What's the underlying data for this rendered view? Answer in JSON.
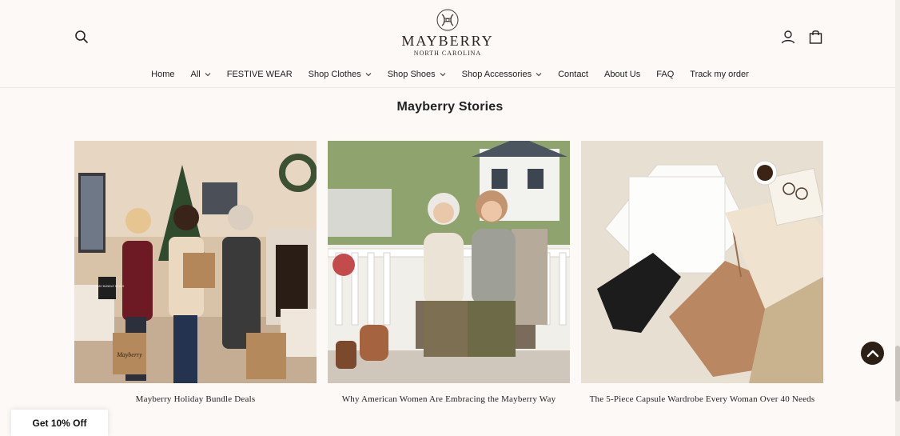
{
  "brand": {
    "name": "MAYBERRY",
    "location": "NORTH CAROLINA"
  },
  "header": {
    "search_icon": "search-icon",
    "account_icon": "user-icon",
    "cart_icon": "shopping-bag-icon"
  },
  "nav": {
    "items": [
      {
        "label": "Home",
        "dropdown": false
      },
      {
        "label": "All",
        "dropdown": true
      },
      {
        "label": "FESTIVE WEAR",
        "dropdown": false
      },
      {
        "label": "Shop Clothes",
        "dropdown": true
      },
      {
        "label": "Shop Shoes",
        "dropdown": true
      },
      {
        "label": "Shop Accessories",
        "dropdown": true
      },
      {
        "label": "Contact",
        "dropdown": false
      },
      {
        "label": "About Us",
        "dropdown": false
      },
      {
        "label": "FAQ",
        "dropdown": false
      },
      {
        "label": "Track my order",
        "dropdown": false
      }
    ]
  },
  "stories": {
    "title": "Mayberry Stories",
    "cards": [
      {
        "title": "Mayberry Holiday Bundle Deals"
      },
      {
        "title": "Why American Women Are Embracing the Mayberry Way"
      },
      {
        "title": "The 5-Piece Capsule Wardrobe Every Woman Over 40 Needs"
      }
    ]
  },
  "images": {
    "card1_bag_text": "Mayberry",
    "card1_sign_text": "HOLIDAY BUNDLE DEALS"
  },
  "promo": {
    "label": "Get 10% Off"
  },
  "colors": {
    "background": "#fdf9f6",
    "accent_dark": "#2c1f16"
  }
}
